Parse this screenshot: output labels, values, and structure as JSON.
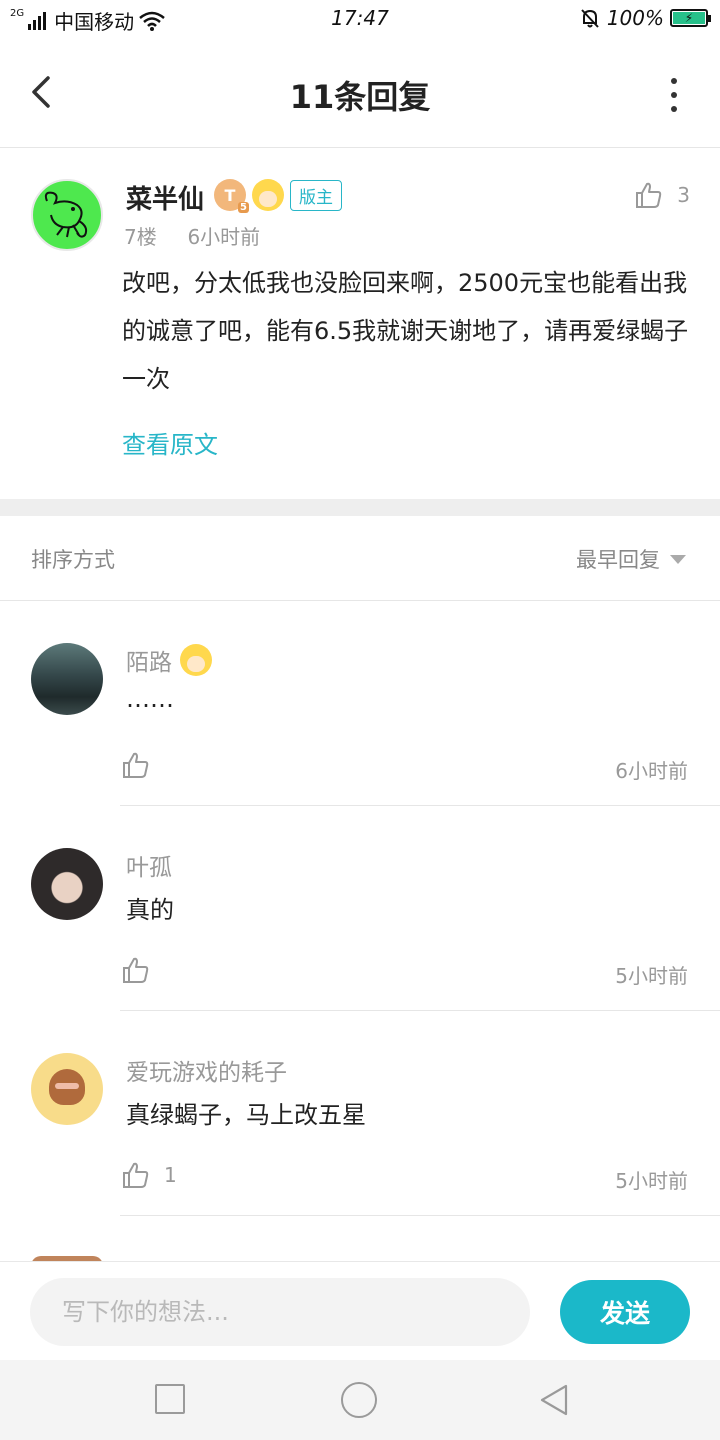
{
  "status_bar": {
    "network_type": "2G",
    "carrier": "中国移动",
    "time": "17:47",
    "battery": "100%",
    "battery_level": 1.0,
    "icons": [
      "signal-icon",
      "wifi-icon",
      "mute-bell-icon",
      "battery-charging-icon"
    ]
  },
  "header": {
    "title": "11条回复",
    "back_icon": "chevron-left-icon",
    "more_icon": "more-vertical-icon"
  },
  "post": {
    "author": "菜半仙",
    "level_badge": "T",
    "level_num": "5",
    "mod_badge": "版主",
    "floor": "7楼",
    "time": "6小时前",
    "like_count": "3",
    "text": "改吧，分太低我也没脸回来啊，2500元宝也能看出我的诚意了吧，能有6.5我就谢天谢地了，请再爱绿蝎子一次",
    "view_original": "查看原文"
  },
  "sort": {
    "label": "排序方式",
    "value": "最早回复"
  },
  "replies": [
    {
      "author": "陌路",
      "text": "……",
      "like_count": "",
      "time": "6小时前"
    },
    {
      "author": "叶孤",
      "text": "真的",
      "like_count": "",
      "time": "5小时前"
    },
    {
      "author": "爱玩游戏的耗子",
      "text": "真绿蝎子，马上改五星",
      "like_count": "1",
      "time": "5小时前"
    }
  ],
  "input": {
    "placeholder": "写下你的想法...",
    "send_label": "发送"
  },
  "colors": {
    "accent": "#1bb8c9",
    "link": "#28b6c8",
    "muted_text": "#999999"
  }
}
